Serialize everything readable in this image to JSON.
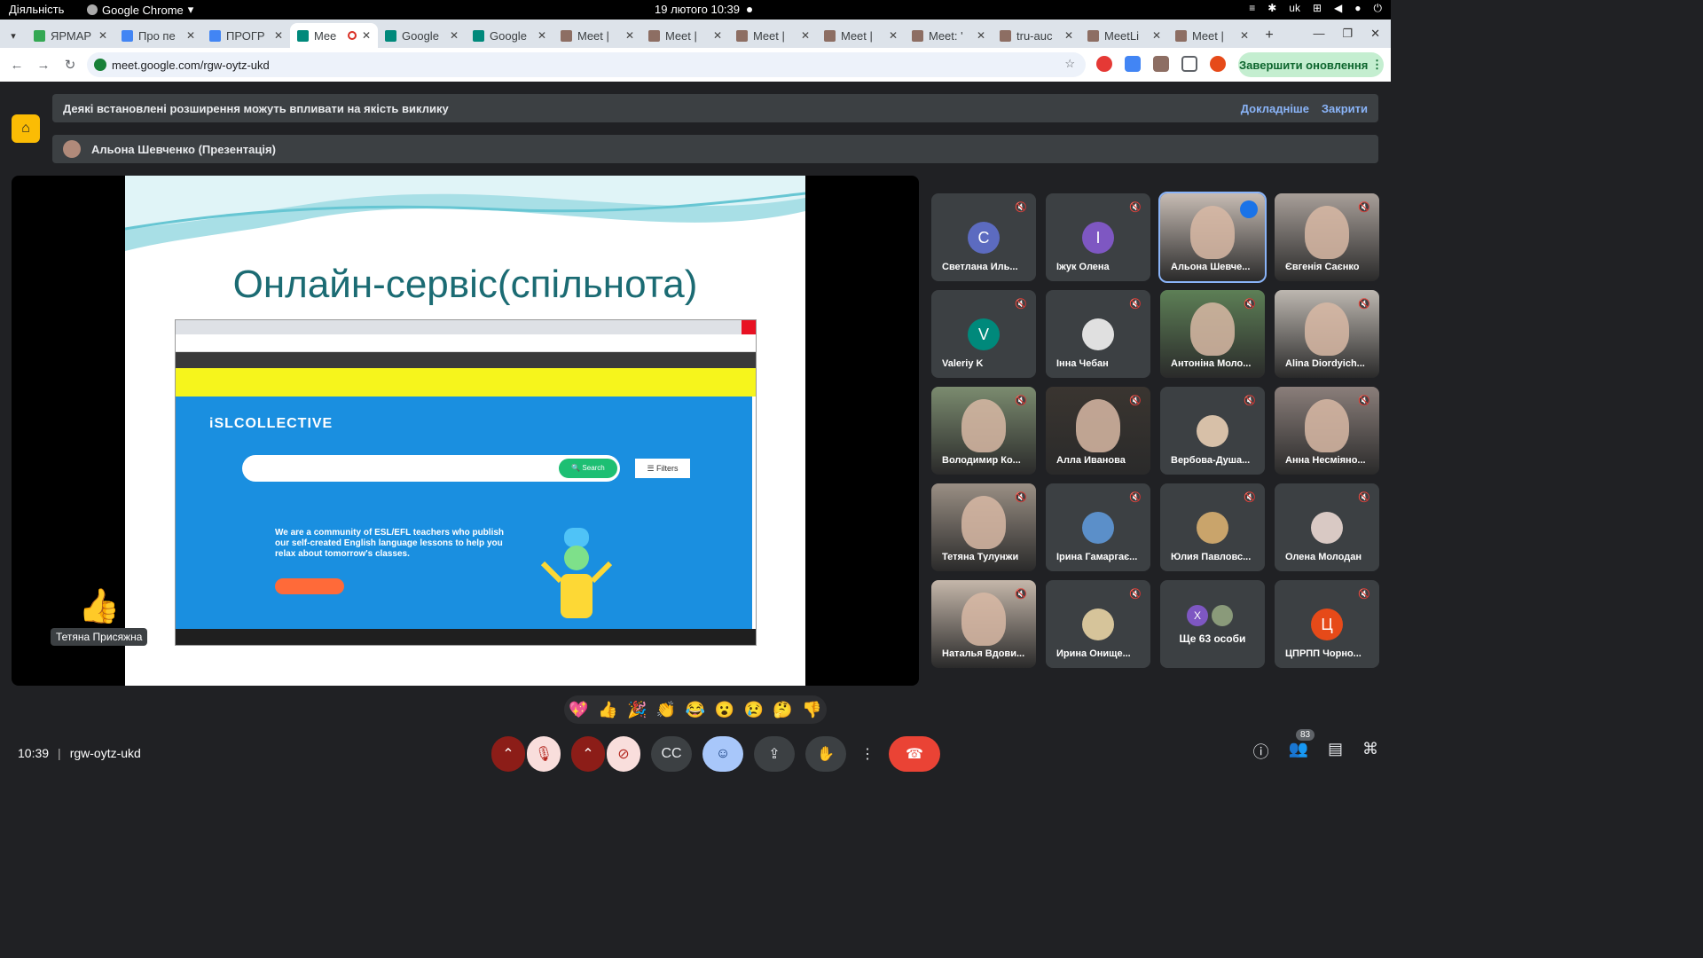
{
  "system": {
    "activities": "Діяльність",
    "app_name": "Google Chrome",
    "datetime": "19 лютого  10:39",
    "lang": "uk"
  },
  "tabs": [
    {
      "label": "ЯРМАР",
      "color": "#34a853"
    },
    {
      "label": "Про пе",
      "color": "#4285f4"
    },
    {
      "label": "ПРОГР",
      "color": "#4285f4"
    },
    {
      "label": "Mee",
      "color": "#00897b",
      "active": true
    },
    {
      "label": "Google",
      "color": "#00897b"
    },
    {
      "label": "Google",
      "color": "#00897b"
    },
    {
      "label": "Meet |",
      "color": "#8d6e63"
    },
    {
      "label": "Meet |",
      "color": "#8d6e63"
    },
    {
      "label": "Meet |",
      "color": "#8d6e63"
    },
    {
      "label": "Meet |",
      "color": "#8d6e63"
    },
    {
      "label": "Meet: '",
      "color": "#8d6e63"
    },
    {
      "label": "tru-auc",
      "color": "#8d6e63"
    },
    {
      "label": "MeetLi",
      "color": "#8d6e63"
    },
    {
      "label": "Meet |",
      "color": "#8d6e63"
    }
  ],
  "address": {
    "url": "meet.google.com/rgw-oytz-ukd",
    "update_button": "Завершити оновлення"
  },
  "meet": {
    "notice": "Деякі встановлені розширення можуть впливати на якість виклику",
    "notice_more": "Докладніше",
    "notice_close": "Закрити",
    "presenter": "Альона Шевченко (Презентація)",
    "slide_title": "Онлайн-сервіс(спільнота)",
    "shot": {
      "logo": "iSLCOLLECTIVE",
      "search": "Search",
      "filters": "Filters",
      "tagline": "We are a community of ESL/EFL teachers who publish our self-created English language lessons to help you relax about tomorrow's classes."
    },
    "reaction_name": "Тетяна Присяжна",
    "participants": [
      {
        "name": "Светлана Иль...",
        "initial": "С",
        "color": "#5c6bc0"
      },
      {
        "name": "Іжук Олена",
        "initial": "І",
        "color": "#7e57c2"
      },
      {
        "name": "Альона Шевче...",
        "video": true,
        "speaking": true,
        "tone": "#c7bcb4"
      },
      {
        "name": "Євгенія Саєнко",
        "video": true,
        "tone": "#a89f99"
      },
      {
        "name": "Valeriy K",
        "initial": "V",
        "color": "#00897b"
      },
      {
        "name": "Інна Чебан",
        "initial": "",
        "color": "#e0e0e0"
      },
      {
        "name": "Антоніна Моло...",
        "video": true,
        "tone": "#5d7f56"
      },
      {
        "name": "Alina Diordyich...",
        "video": true,
        "tone": "#bdb7b0"
      },
      {
        "name": "Володимир Ко...",
        "video": true,
        "tone": "#7b8b6f"
      },
      {
        "name": "Алла Иванова",
        "video": true,
        "tone": "#3a3530"
      },
      {
        "name": "Вербова-Душа...",
        "initial": "",
        "color": "#d7c0a8"
      },
      {
        "name": "Анна Несміяно...",
        "video": true,
        "tone": "#8a7e7a"
      },
      {
        "name": "Тетяна Тулунжи",
        "video": true,
        "tone": "#9a8f84"
      },
      {
        "name": "Ірина Гамаргає...",
        "initial": "",
        "color": "#5b8fc9"
      },
      {
        "name": "Юлия Павловс...",
        "initial": "",
        "color": "#c9a46b"
      },
      {
        "name": "Олена Молодан",
        "initial": "",
        "color": "#d9c9c4"
      },
      {
        "name": "Наталья Вдови...",
        "video": true,
        "tone": "#c5b7aa"
      },
      {
        "name": "Ирина Онище...",
        "initial": "",
        "color": "#d6c49a"
      },
      {
        "name": "Ще 63 особи",
        "initial": "X",
        "color": "#7e57c2",
        "more": true
      },
      {
        "name": "ЦПРПП Чорно...",
        "initial": "Ц",
        "color": "#e64a19"
      }
    ],
    "reactions": [
      "💖",
      "👍",
      "🎉",
      "👏",
      "😂",
      "😮",
      "😢",
      "🤔",
      "👎"
    ],
    "time": "10:39",
    "code": "rgw-oytz-ukd",
    "people_count": "83"
  }
}
